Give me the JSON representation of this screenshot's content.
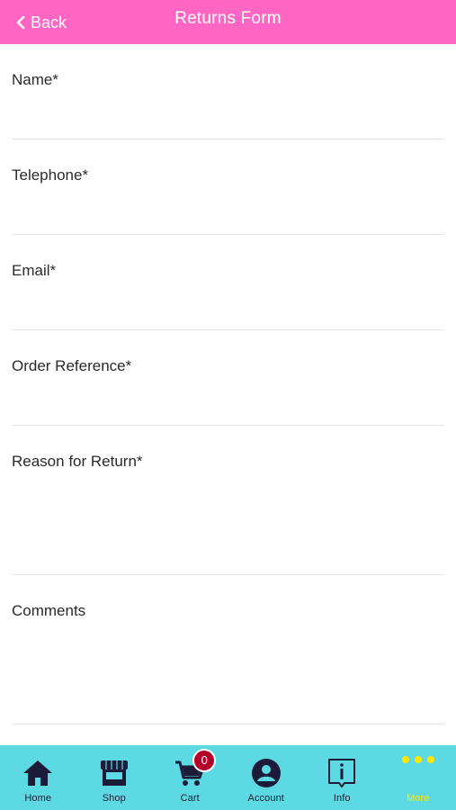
{
  "header": {
    "back_label": "Back",
    "title": "Returns Form"
  },
  "form": {
    "fields": [
      {
        "label": "Name*",
        "value": "",
        "placeholder": ""
      },
      {
        "label": "Telephone*",
        "value": "",
        "placeholder": ""
      },
      {
        "label": "Email*",
        "value": "",
        "placeholder": ""
      },
      {
        "label": "Order Reference*",
        "value": "",
        "placeholder": ""
      },
      {
        "label": "Reason for Return*",
        "value": "",
        "placeholder": ""
      },
      {
        "label": "Comments",
        "value": "",
        "placeholder": ""
      }
    ]
  },
  "tabbar": {
    "items": [
      {
        "label": "Home",
        "icon": "home-icon"
      },
      {
        "label": "Shop",
        "icon": "shop-icon"
      },
      {
        "label": "Cart",
        "icon": "cart-icon",
        "badge": "0"
      },
      {
        "label": "Account",
        "icon": "account-icon"
      },
      {
        "label": "Info",
        "icon": "info-icon"
      },
      {
        "label": "More",
        "icon": "more-icon"
      }
    ]
  },
  "colors": {
    "header_bg": "#ff66c4",
    "tabbar_bg": "#5dd9e3",
    "tab_icon": "#1c1c3a",
    "active_more": "#ffe600",
    "badge_bg": "#b3002a"
  }
}
